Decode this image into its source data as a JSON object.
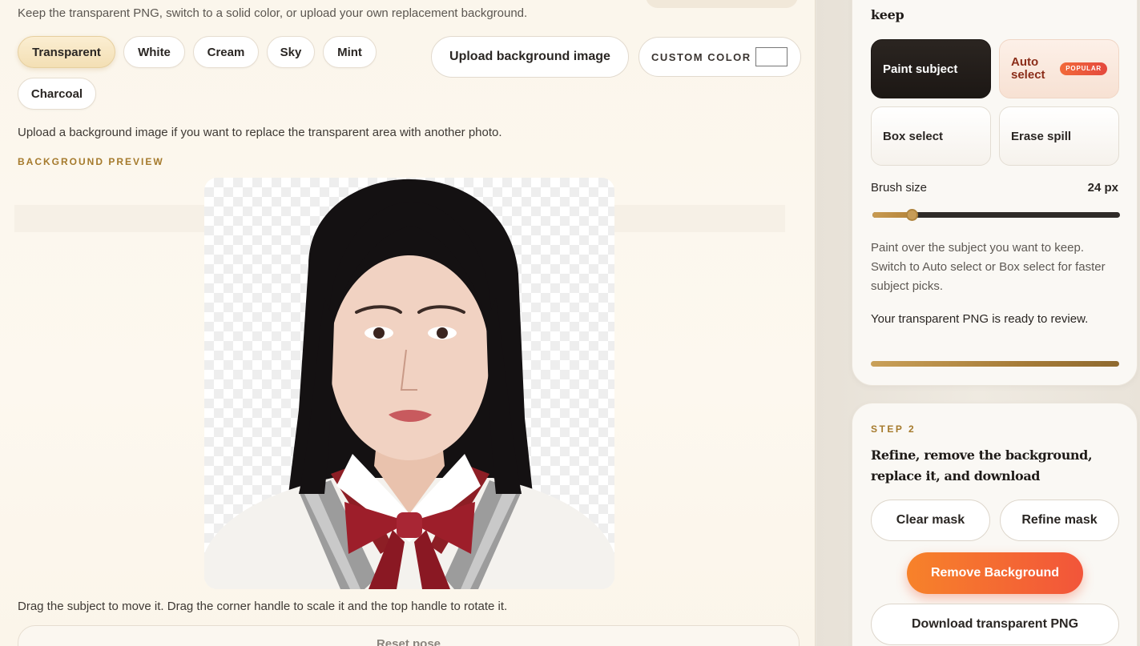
{
  "left": {
    "intro": "Keep the transparent PNG, switch to a solid color, or upload your own replacement background.",
    "backgrounds": [
      "Transparent",
      "White",
      "Cream",
      "Sky",
      "Mint",
      "Charcoal"
    ],
    "selected_background": "Transparent",
    "upload_label": "Upload background image",
    "custom_color_label": "CUSTOM COLOR",
    "custom_color_value": "#ffffff",
    "hint": "Upload a background image if you want to replace the transparent area with another photo.",
    "preview_label": "BACKGROUND PREVIEW",
    "drag_hint": "Drag the subject to move it. Drag the corner handle to scale it and the top handle to rotate it.",
    "reset_label": "Reset pose"
  },
  "right": {
    "keep_title": "keep",
    "tools": {
      "paint": "Paint subject",
      "auto": "Auto select",
      "auto_badge": "POPULAR",
      "box": "Box select",
      "erase": "Erase spill"
    },
    "brush_label": "Brush size",
    "brush_value": "24 px",
    "brush_fraction": 0.16,
    "help": "Paint over the subject you want to keep. Switch to Auto select or Box select for faster subject picks.",
    "status": "Your transparent PNG is ready to review.",
    "step_label": "STEP 2",
    "step_title": "Refine, remove the background, replace it, and download",
    "clear_mask": "Clear mask",
    "refine_mask": "Refine mask",
    "remove_bg": "Remove Background",
    "download": "Download transparent PNG"
  },
  "colors": {
    "accent": "#a57a2c",
    "primary_orange": "#f2553a",
    "dark_button": "#1f1a17"
  }
}
